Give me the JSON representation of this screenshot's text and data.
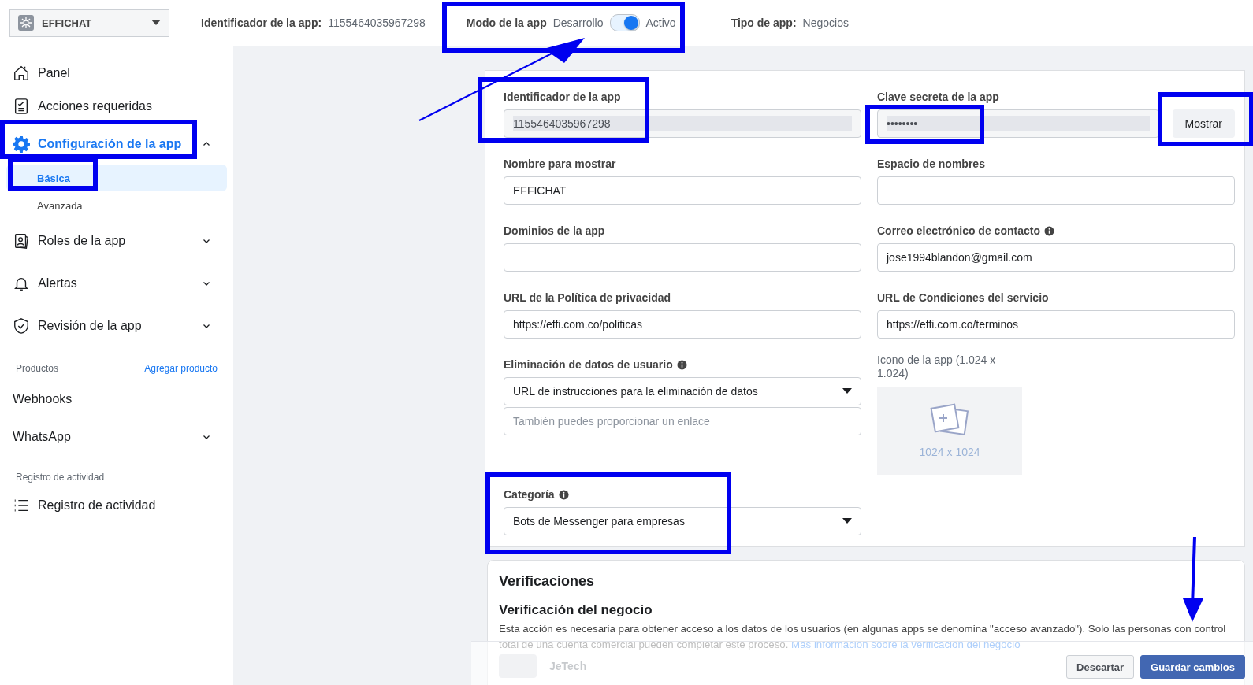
{
  "app_selector": {
    "name": "EFFICHAT"
  },
  "header": {
    "app_id_label": "Identificador de la app:",
    "app_id": "1155464035967298",
    "mode_label": "Modo de la app",
    "mode_value": "Desarrollo",
    "mode_active": true,
    "active_label": "Activo",
    "type_label": "Tipo de app:",
    "type_value": "Negocios"
  },
  "sidebar": {
    "items": [
      {
        "kind": "nav",
        "label": "Panel",
        "selected": false
      },
      {
        "kind": "nav",
        "label": "Acciones requeridas",
        "selected": false
      },
      {
        "kind": "nav",
        "label": "Configuración de la app",
        "selected": true,
        "expanded": true,
        "children": [
          {
            "label": "Básica",
            "selected": true
          },
          {
            "label": "Avanzada",
            "selected": false
          }
        ]
      },
      {
        "kind": "nav",
        "label": "Roles de la app",
        "selected": false,
        "expanded": false
      },
      {
        "kind": "nav",
        "label": "Alertas",
        "selected": false,
        "expanded": false
      },
      {
        "kind": "nav",
        "label": "Revisión de la app",
        "selected": false,
        "expanded": false
      },
      {
        "kind": "section",
        "label": "Productos",
        "link": "Agregar producto"
      },
      {
        "kind": "product",
        "label": "Webhooks"
      },
      {
        "kind": "product",
        "label": "WhatsApp",
        "expanded": false
      },
      {
        "kind": "section",
        "label": "Registro de actividad"
      },
      {
        "kind": "nav",
        "label": "Registro de actividad",
        "selected": false
      }
    ]
  },
  "form": {
    "fields": [
      {
        "kind": "readonly",
        "label": "Identificador de la app",
        "info": false,
        "value": "1155464035967298"
      },
      {
        "kind": "secret",
        "label": "Clave secreta de la app",
        "info": false,
        "value": "••••••••",
        "button": "Mostrar"
      },
      {
        "kind": "text",
        "label": "Nombre para mostrar",
        "info": false,
        "value": "EFFICHAT"
      },
      {
        "kind": "text",
        "label": "Espacio de nombres",
        "info": false
      },
      {
        "kind": "text",
        "label": "Dominios de la app",
        "info": false
      },
      {
        "kind": "text",
        "label": "Correo electrónico de contacto",
        "info": true,
        "value": "jose1994blandon@gmail.com"
      },
      {
        "kind": "text",
        "label": "URL de la Política de privacidad",
        "info": false,
        "value": "https://effi.com.co/politicas"
      },
      {
        "kind": "text",
        "label": "URL de Condiciones del servicio",
        "info": false,
        "value": "https://effi.com.co/terminos"
      },
      {
        "kind": "select",
        "label": "Eliminación de datos de usuario",
        "info": true,
        "value": "URL de instrucciones para la eliminación de datos",
        "placeholder": "También puedes proporcionar un enlace"
      },
      {
        "kind": "image",
        "label": "Icono de la app (1.024 x 1.024)",
        "info": false,
        "caption": "1024 x 1024"
      },
      {
        "kind": "select",
        "label": "Categoría",
        "info": true,
        "value": "Bots de Messenger para empresas"
      }
    ]
  },
  "verifications": {
    "title": "Verificaciones",
    "subtitle": "Verificación del negocio",
    "text": "Esta acción es necesaria para obtener acceso a los datos de los usuarios (en algunas apps se denomina \"acceso avanzado\"). Solo las personas con control total de una cuenta comercial pueden completar este proceso.",
    "link": "Más información sobre la verificación del negocio",
    "business": "JeTech"
  },
  "footer": {
    "buttons": [
      {
        "kind": "secondary",
        "label": "Descartar"
      },
      {
        "kind": "primary",
        "label": "Guardar cambios"
      }
    ]
  }
}
